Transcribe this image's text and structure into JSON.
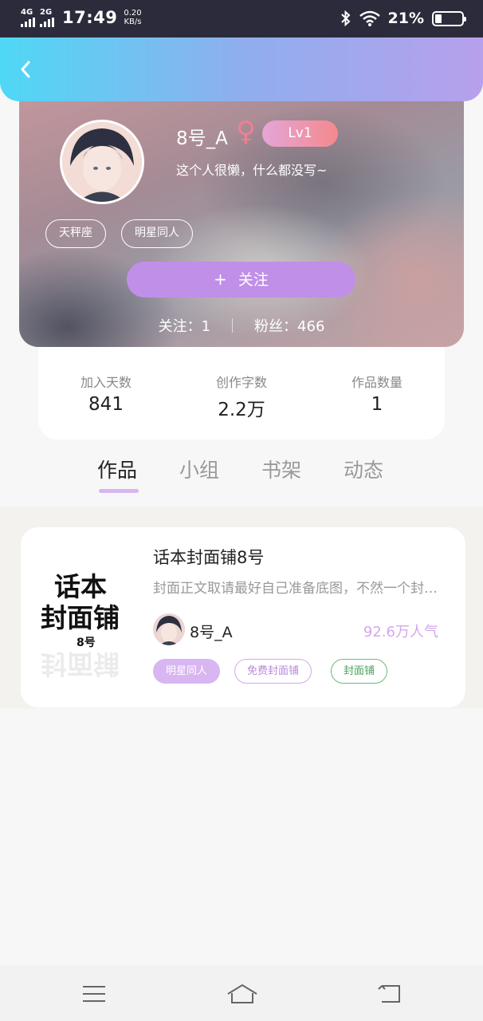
{
  "status_bar": {
    "network1": "4G",
    "network2": "2G",
    "time": "17:49",
    "speed_value": "0.20",
    "speed_unit": "KB/s",
    "battery": "21%"
  },
  "header": {
    "back_icon": "chevron-left-icon"
  },
  "profile": {
    "username": "8号_A",
    "gender_symbol": "♀",
    "level": "Lv1",
    "bio": "这个人很懒，什么都没写~",
    "tags": [
      "天秤座",
      "明星同人"
    ],
    "follow_button": "关注",
    "follow_plus": "+",
    "following": "关注：1",
    "fans": "粉丝：466"
  },
  "stats": [
    {
      "label": "加入天数",
      "value": "841"
    },
    {
      "label": "创作字数",
      "value": "2.2万"
    },
    {
      "label": "作品数量",
      "value": "1"
    }
  ],
  "tabs": [
    "作品",
    "小组",
    "书架",
    "动态"
  ],
  "work": {
    "cover_line1": "话本",
    "cover_line2": "封面铺",
    "cover_line3": "8号",
    "title": "话本封面铺8号",
    "description": "封面正文取请最好自己准备底图，不然一个封面要等好久",
    "author": "8号_A",
    "popularity": "92.6万人气",
    "chips": [
      "明星同人",
      "免费封面铺",
      "封面铺"
    ]
  },
  "colors": {
    "accent": "#c08fe8",
    "header_gradient_start": "#4fd8f5",
    "header_gradient_end": "#b7a0ec",
    "level_gradient_start": "#e4a6d7",
    "level_gradient_end": "#f4898d"
  }
}
